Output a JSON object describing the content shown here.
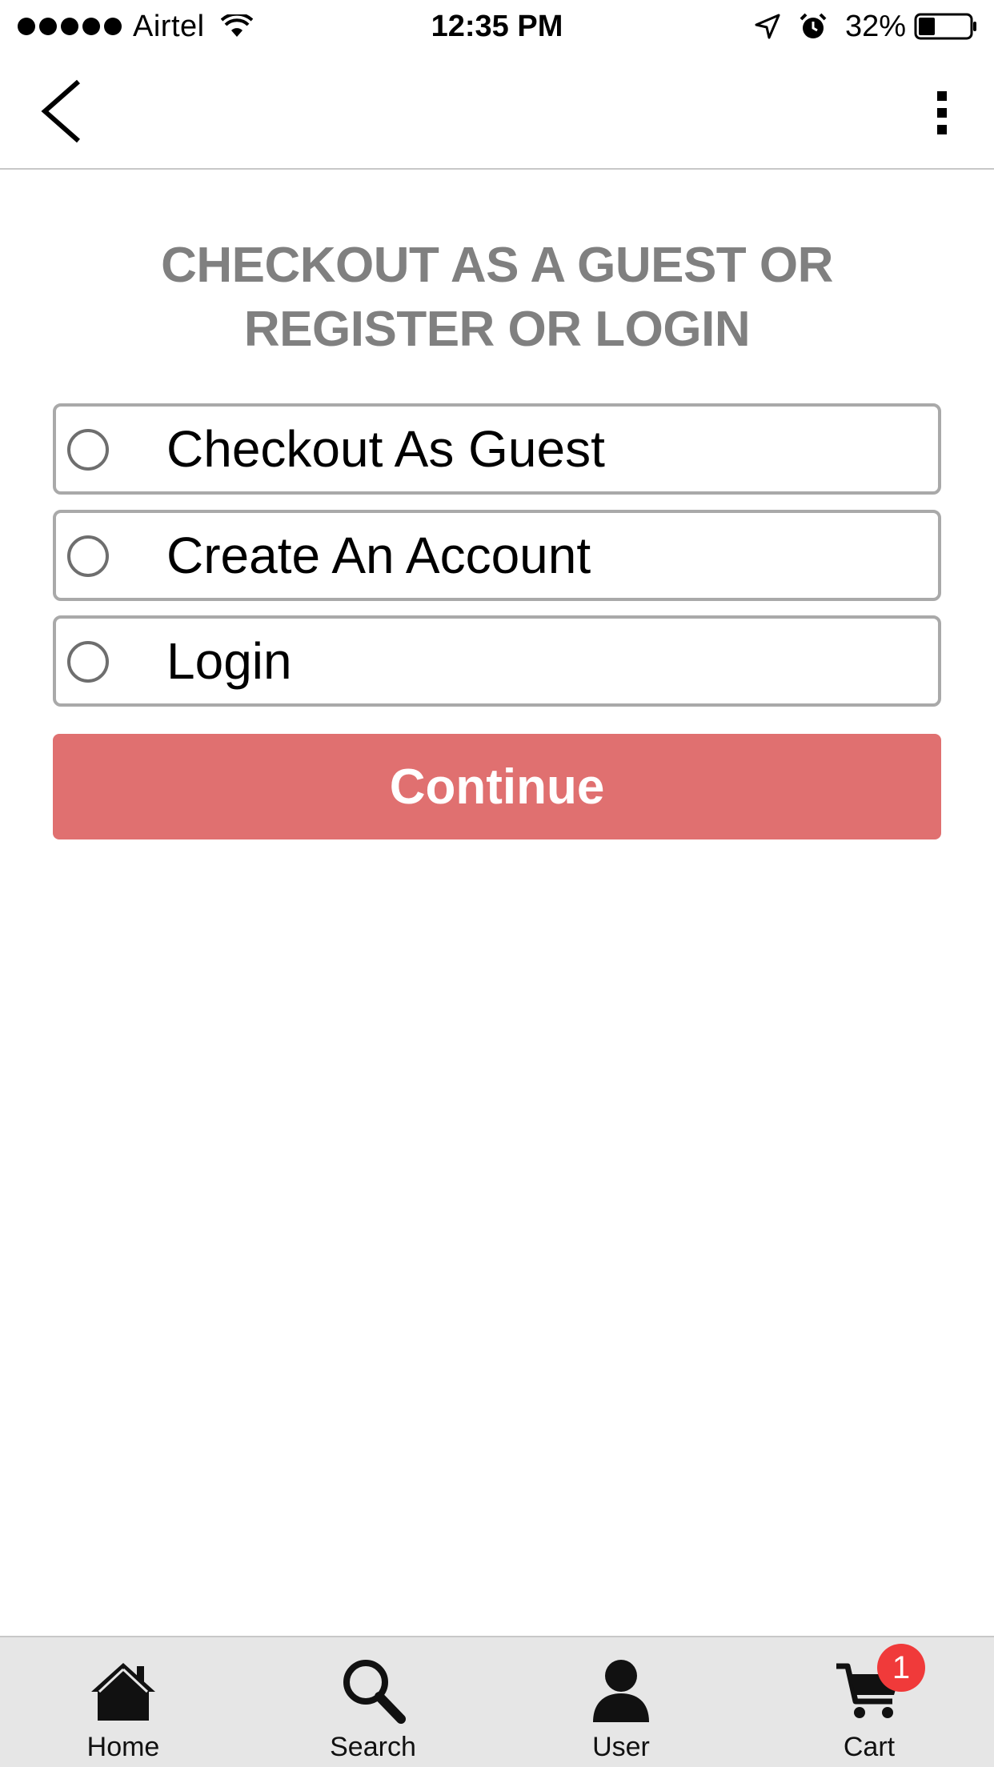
{
  "status_bar": {
    "carrier": "Airtel",
    "time": "12:35 PM",
    "battery_percent": "32%",
    "battery_level": 0.32,
    "icons": [
      "signal-icon",
      "wifi-icon",
      "location-icon",
      "alarm-icon",
      "battery-icon"
    ]
  },
  "nav": {
    "back_icon": "chevron-left-icon",
    "menu_icon": "more-vertical-icon"
  },
  "main": {
    "heading_line1": "CHECKOUT AS A GUEST OR",
    "heading_line2": "REGISTER OR LOGIN",
    "options": [
      {
        "label": "Checkout As Guest",
        "selected": false
      },
      {
        "label": "Create An Account",
        "selected": false
      },
      {
        "label": "Login",
        "selected": false
      }
    ],
    "continue_label": "Continue"
  },
  "tab_bar": {
    "tabs": [
      {
        "label": "Home",
        "icon": "home-icon"
      },
      {
        "label": "Search",
        "icon": "search-icon"
      },
      {
        "label": "User",
        "icon": "user-icon"
      },
      {
        "label": "Cart",
        "icon": "cart-icon",
        "badge": "1"
      }
    ]
  },
  "colors": {
    "accent": "#e07070",
    "heading": "#808080",
    "badge": "#f03a3a",
    "tab_bar_bg": "#e6e6e6"
  }
}
